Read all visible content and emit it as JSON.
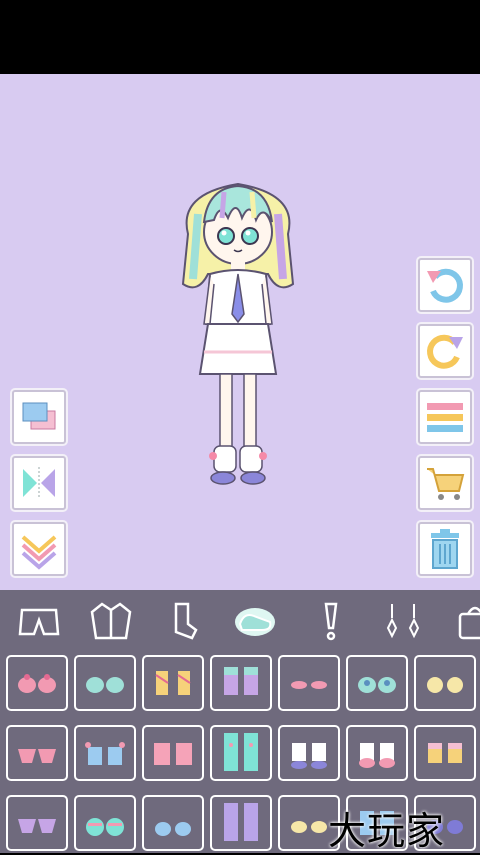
{
  "app": {
    "watermark": "大玩家"
  },
  "colors": {
    "stage_bg": "#d8cbf1",
    "panel_bg": "#6f6a7d",
    "accent_pink": "#f29ab2",
    "accent_blue": "#7fc6e9"
  },
  "tools_left": [
    {
      "name": "layer-icon"
    },
    {
      "name": "mirror-flip-icon"
    },
    {
      "name": "move-down-icon"
    }
  ],
  "tools_right": [
    {
      "name": "undo-icon"
    },
    {
      "name": "redo-icon"
    },
    {
      "name": "menu-icon"
    },
    {
      "name": "shop-cart-icon"
    },
    {
      "name": "trash-icon"
    }
  ],
  "categories": [
    {
      "name": "shorts-icon",
      "selected": false
    },
    {
      "name": "jacket-icon",
      "selected": false
    },
    {
      "name": "socks-icon",
      "selected": false
    },
    {
      "name": "shoes-icon",
      "selected": true
    },
    {
      "name": "exclamation-icon",
      "selected": false
    },
    {
      "name": "earrings-icon",
      "selected": false
    },
    {
      "name": "bag-icon",
      "selected": false
    }
  ],
  "items_grid": {
    "rows": 3,
    "columns": 7
  }
}
